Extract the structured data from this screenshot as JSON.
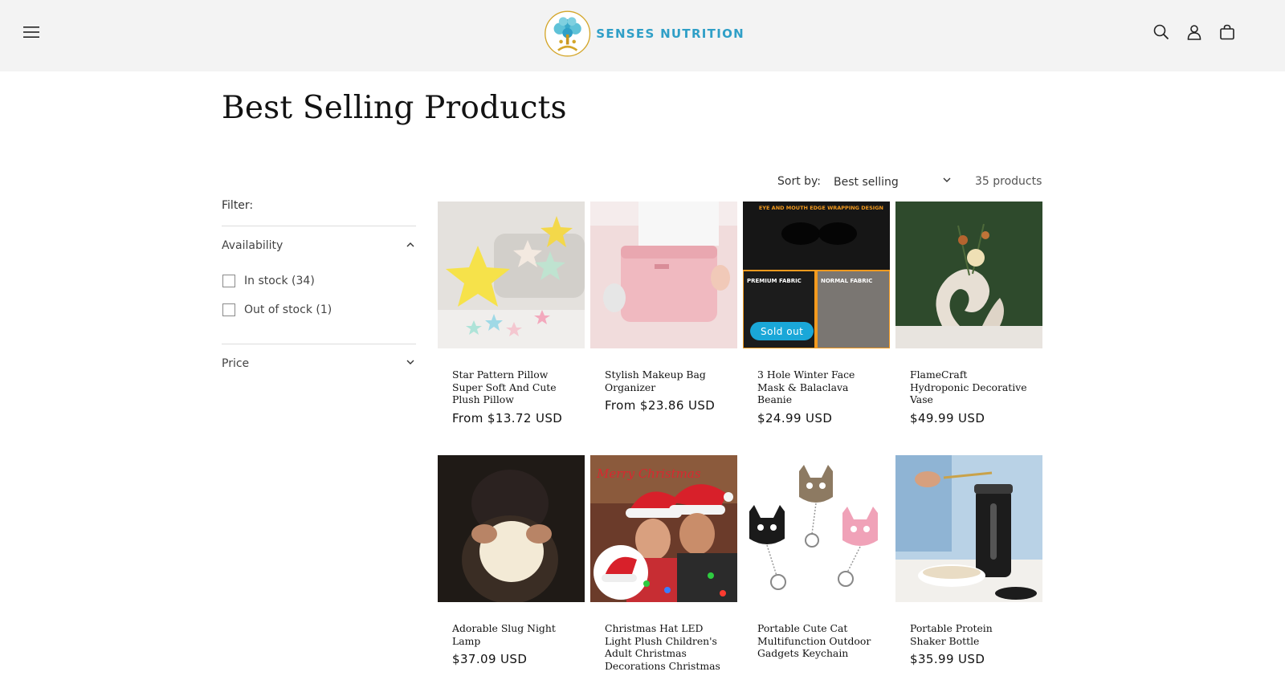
{
  "brand": {
    "name": "SENSES NUTRITION",
    "color": "#2f9fc7",
    "accent": "#d4a62a"
  },
  "header": {
    "menu_icon": "hamburger-icon",
    "icons": [
      "search-icon",
      "account-icon",
      "cart-icon"
    ]
  },
  "page": {
    "title": "Best Selling Products"
  },
  "sort": {
    "label": "Sort by:",
    "selected": "Best selling",
    "count": "35 products"
  },
  "filter": {
    "label": "Filter:",
    "availability": {
      "label": "Availability",
      "options": [
        {
          "label": "In stock (34)",
          "checked": false
        },
        {
          "label": "Out of stock (1)",
          "checked": false
        }
      ]
    },
    "price": {
      "label": "Price"
    }
  },
  "products": [
    {
      "title": "Star Pattern Pillow Super Soft And Cute Plush Pillow",
      "price": "From $13.72 USD"
    },
    {
      "title": "Stylish Makeup Bag Organizer",
      "price": "From $23.86 USD"
    },
    {
      "title": "3 Hole Winter Face Mask & Balaclava Beanie",
      "price": "$24.99 USD",
      "badge": "Sold out",
      "image_text": {
        "banner": "EYE AND MOUTH EDGE WRAPPING DESIGN",
        "left": "PREMIUM FABRIC",
        "right": "NORMAL FABRIC"
      }
    },
    {
      "title": "FlameCraft Hydroponic Decorative Vase",
      "price": "$49.99 USD"
    },
    {
      "title": "Adorable Slug Night Lamp",
      "price": "$37.09 USD"
    },
    {
      "title": "Christmas Hat LED Light Plush Children's Adult Christmas Decorations Christmas",
      "price": "",
      "image_text": {
        "caption": "Merry Christmas"
      }
    },
    {
      "title": "Portable Cute Cat Multifunction Outdoor Gadgets Keychain",
      "price": ""
    },
    {
      "title": "Portable Protein Shaker Bottle",
      "price": "$35.99 USD"
    }
  ]
}
